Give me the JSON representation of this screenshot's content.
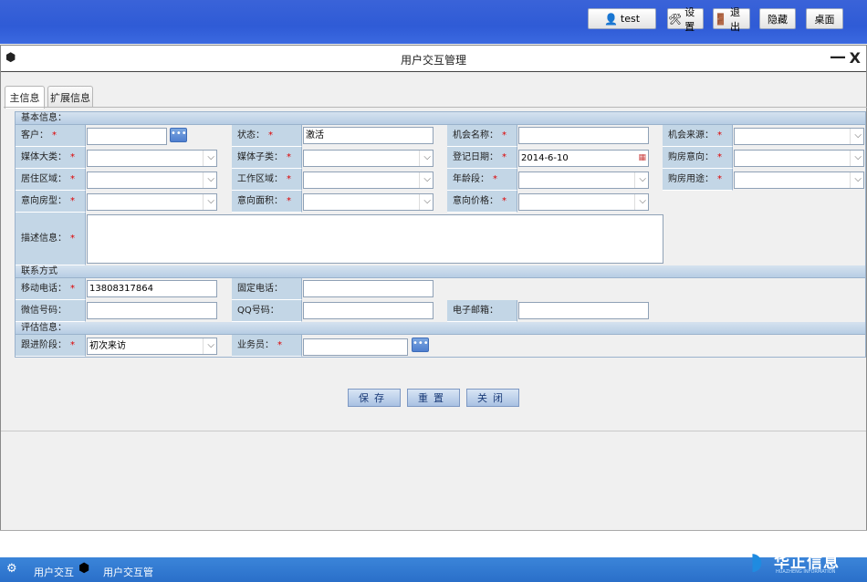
{
  "top_buttons": {
    "user": "test",
    "settings": "设置",
    "logout": "退出",
    "hide": "隐藏",
    "desktop": "桌面"
  },
  "window": {
    "title": "用户交互管理",
    "minimize": "—",
    "close": "X"
  },
  "tabs": [
    "主信息",
    "扩展信息"
  ],
  "sections": {
    "basic": "基本信息：",
    "contact": "联系方式",
    "eval": "评估信息："
  },
  "labels": {
    "customer": "客户：",
    "status": "状态：",
    "opp_name": "机会名称：",
    "opp_source": "机会来源：",
    "media_cat": "媒体大类：",
    "media_sub": "媒体子类：",
    "reg_date": "登记日期：",
    "intent": "购房意向：",
    "living_area": "居住区域：",
    "work_area": "工作区域：",
    "age": "年龄段：",
    "purpose": "购房用途：",
    "house_type": "意向房型：",
    "area": "意向面积：",
    "price": "意向价格：",
    "desc": "描述信息：",
    "mobile": "移动电话：",
    "phone": "固定电话：",
    "wechat": "微信号码：",
    "qq": "QQ号码：",
    "email": "电子邮箱：",
    "follow_stage": "跟进阶段：",
    "salesman": "业务员："
  },
  "required_mark": "*",
  "values": {
    "status": "激活",
    "reg_date": "2014-6-10",
    "mobile": "13808317864",
    "follow_stage": "初次来访"
  },
  "buttons": {
    "save": "保存",
    "reset": "重置",
    "close": "关闭"
  },
  "taskbar": {
    "item1": "用户交互",
    "item2": "用户交互管"
  },
  "logo": {
    "cn": "华正信息",
    "en": "HUAZHENG INFORMATION"
  }
}
